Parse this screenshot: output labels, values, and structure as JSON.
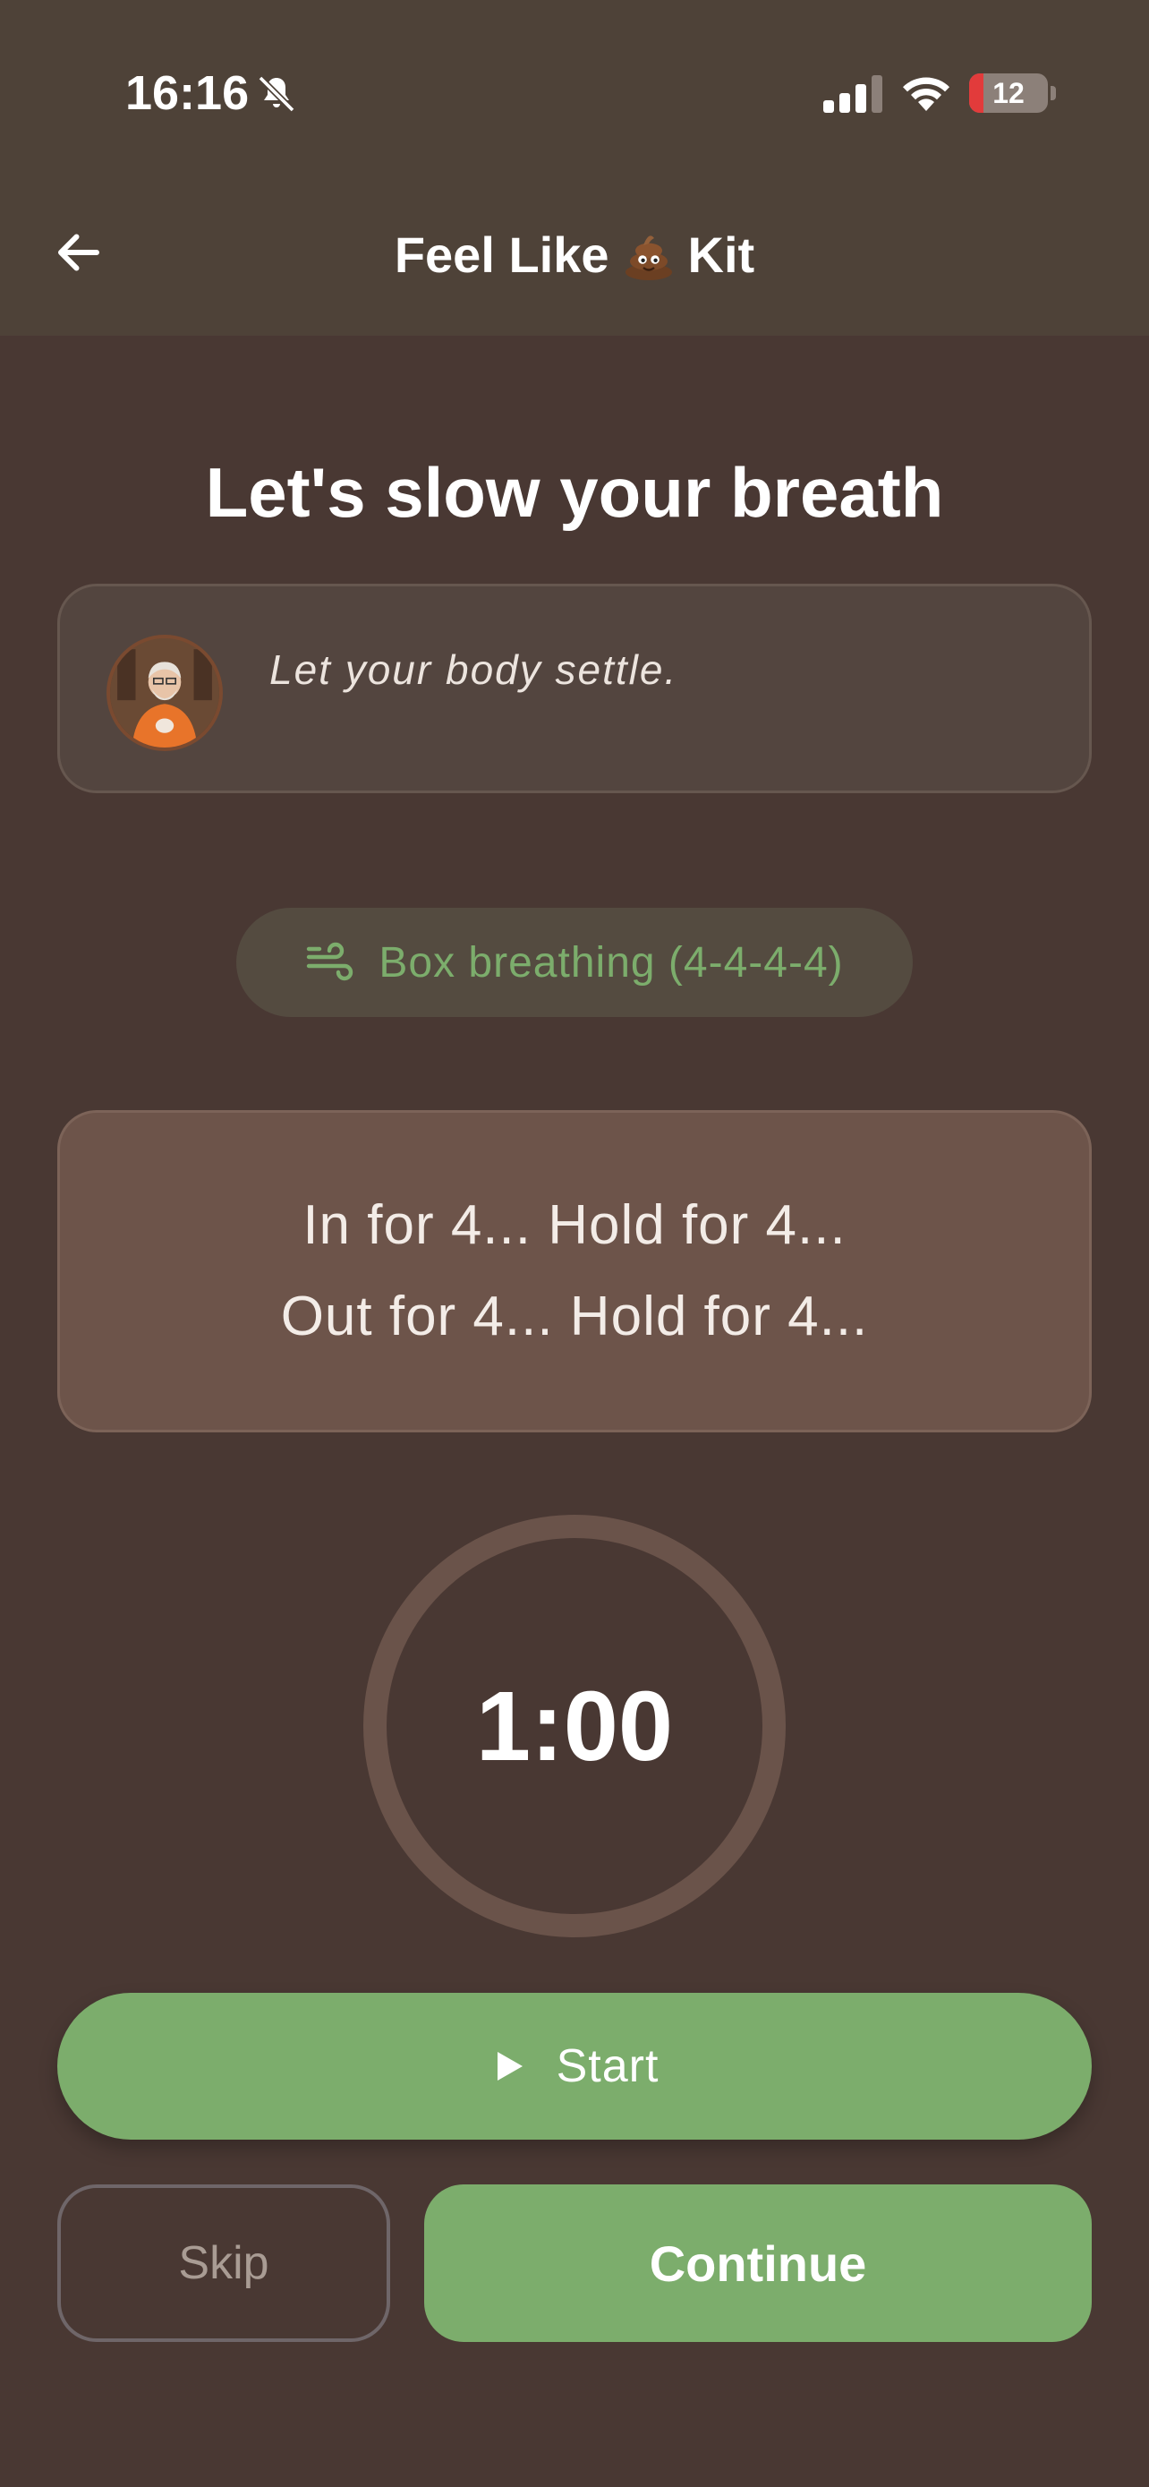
{
  "status_bar": {
    "time": "16:16",
    "battery": "12",
    "icons": [
      "bell-slash-icon",
      "signal-icon",
      "wifi-icon",
      "battery-icon"
    ]
  },
  "nav": {
    "title_prefix": "Feel Like",
    "title_suffix": "Kit",
    "title_emoji": "poop-icon",
    "back_icon": "arrow-left-icon"
  },
  "page": {
    "title": "Let's slow your breath"
  },
  "quote": {
    "text": "Let your body settle."
  },
  "technique": {
    "label": "Box breathing (4-4-4-4)",
    "icon": "wind-icon"
  },
  "instructions": {
    "line1": "In for 4... Hold for 4...",
    "line2": "Out for 4... Hold for 4..."
  },
  "timer": {
    "value": "1:00"
  },
  "actions": {
    "start_label": "Start",
    "skip_label": "Skip",
    "continue_label": "Continue"
  },
  "colors": {
    "background": "#493833",
    "header": "#4e4238",
    "accent_green": "#7cad6c",
    "instruction_card": "#6d544a",
    "battery_low": "#e23b3b"
  }
}
